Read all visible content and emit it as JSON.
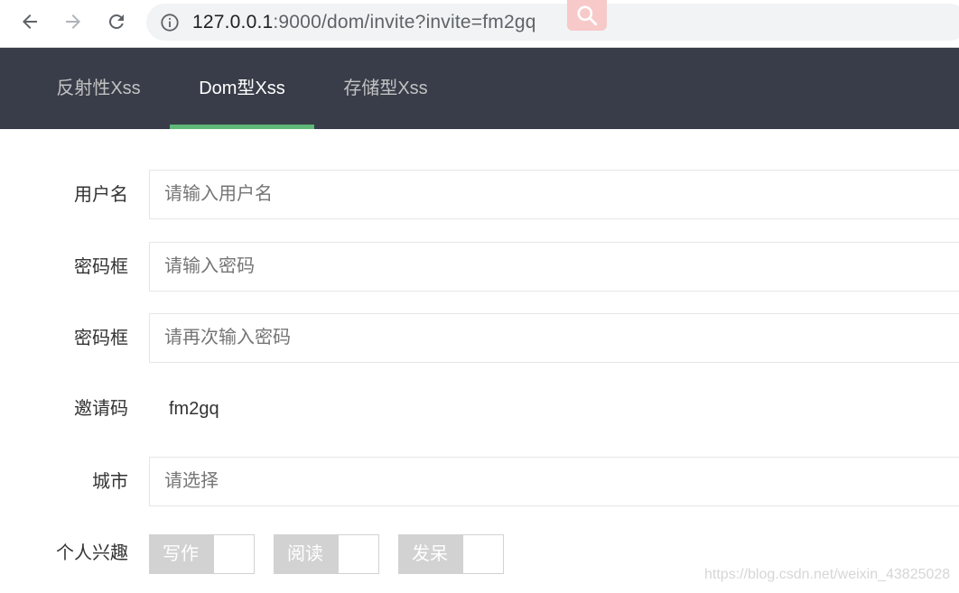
{
  "browser": {
    "url_host": "127.0.0.1",
    "url_rest": ":9000/dom/invite?invite=fm2gq"
  },
  "tabs": [
    {
      "label": "反射性Xss",
      "active": false
    },
    {
      "label": "Dom型Xss",
      "active": true
    },
    {
      "label": "存储型Xss",
      "active": false
    }
  ],
  "form": {
    "username": {
      "label": "用户名",
      "placeholder": "请输入用户名"
    },
    "password": {
      "label": "密码框",
      "placeholder": "请输入密码"
    },
    "password_confirm": {
      "label": "密码框",
      "placeholder": "请再次输入密码"
    },
    "invite": {
      "label": "邀请码",
      "value": "fm2gq"
    },
    "city": {
      "label": "城市",
      "placeholder": "请选择"
    },
    "interests": {
      "label": "个人兴趣",
      "options": [
        "写作",
        "阅读",
        "发呆"
      ]
    }
  },
  "colors": {
    "tabbar_bg": "#393d49",
    "active_indicator": "#5fb878",
    "checkbox_unchecked": "#d2d2d2"
  },
  "watermark": "https://blog.csdn.net/weixin_43825028"
}
